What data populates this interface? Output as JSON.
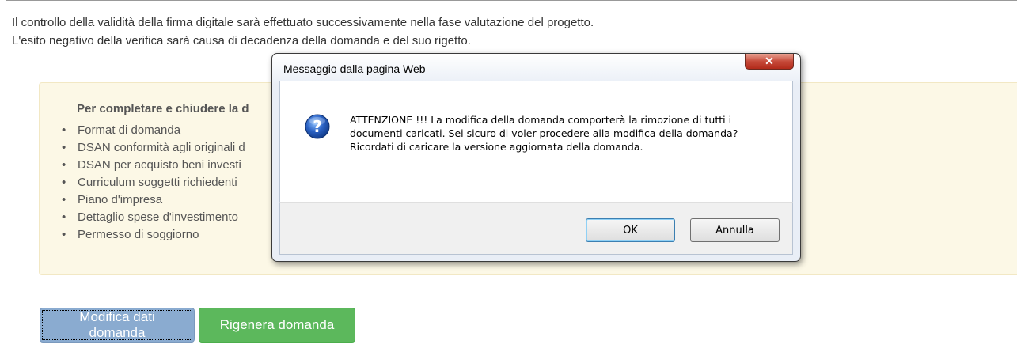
{
  "page": {
    "intro_lines": [
      "Il controllo della validità della firma digitale sarà effettuato successivamente nella fase valutazione del progetto.",
      "L'esito negativo della verifica sarà causa di decadenza della domanda e del suo rigetto."
    ],
    "note": {
      "title": "Per completare e chiudere la d",
      "items": [
        "Format di domanda",
        "DSAN conformità agli originali d",
        "DSAN per acquisto beni investi",
        "Curriculum soggetti richiedenti",
        "Piano d'impresa",
        "Dettaglio spese d'investimento",
        "Permesso di soggiorno"
      ]
    },
    "buttons": {
      "modifica_label": "Modifica dati domanda",
      "rigenera_label": "Rigenera domanda"
    }
  },
  "dialog": {
    "title": "Messaggio dalla pagina Web",
    "close_glyph": "✕",
    "icon": "question-icon",
    "message": "ATTENZIONE !!! La modifica della domanda comporterà la rimozione di tutti i documenti caricati. Sei sicuro di voler procedere alla modifica della domanda? Ricordati di caricare la versione aggiornata della domanda.",
    "ok_label": "OK",
    "cancel_label": "Annulla"
  },
  "colors": {
    "note_bg": "#fcf8e6",
    "modifica_btn": "#8aabd0",
    "rigenera_btn": "#5cb85c",
    "close_btn": "#c74b3b"
  }
}
